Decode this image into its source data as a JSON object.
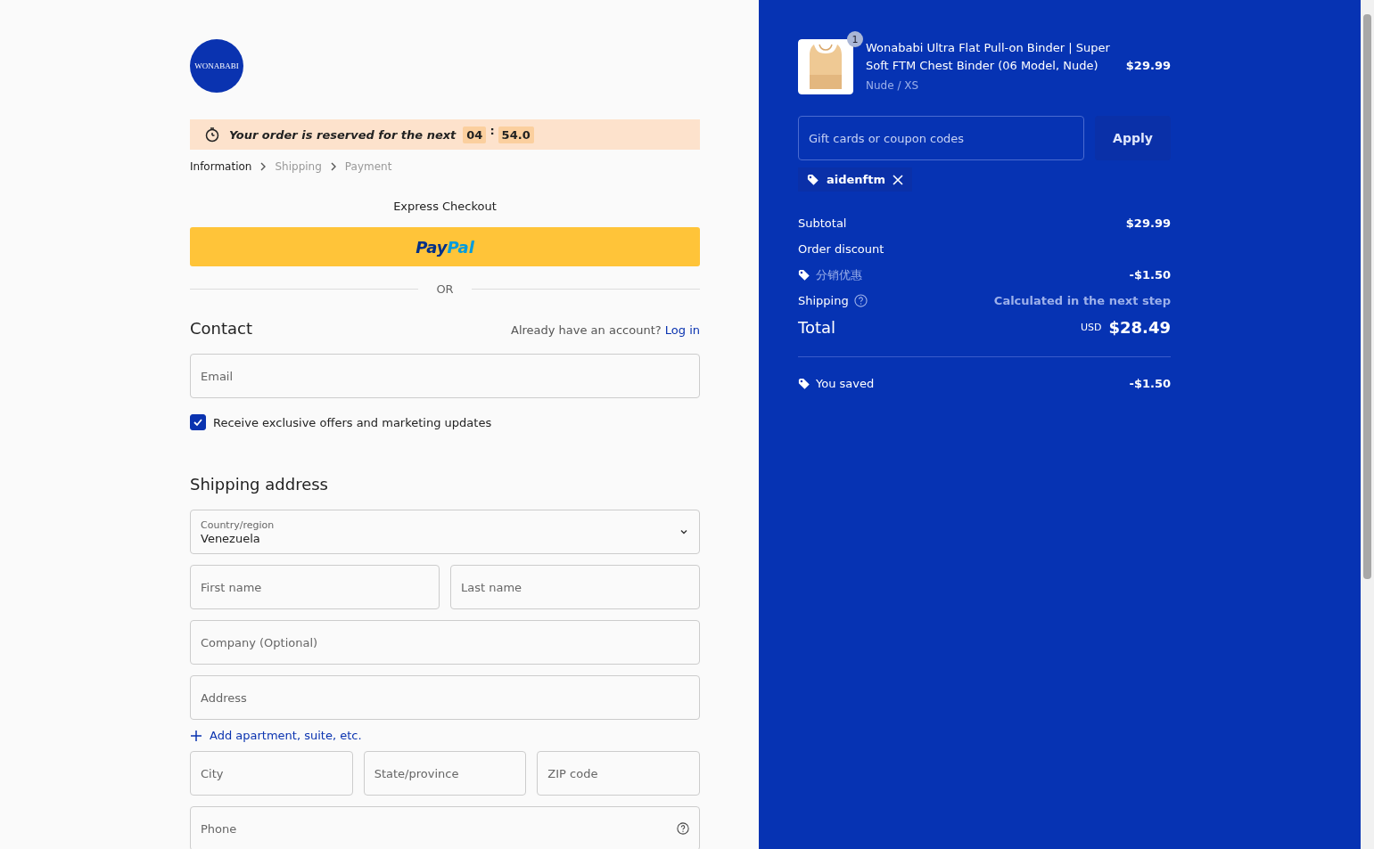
{
  "logo": {
    "text": "WONABABI"
  },
  "reservation": {
    "text": "Your order is reserved for the next",
    "minutes": "04",
    "separator": ":",
    "seconds": "54.0"
  },
  "breadcrumbs": [
    {
      "label": "Information",
      "selected": true
    },
    {
      "label": "Shipping",
      "selected": false
    },
    {
      "label": "Payment",
      "selected": false
    }
  ],
  "express_checkout": {
    "title": "Express Checkout",
    "paypal": {
      "pay": "Pay",
      "pal": "Pal"
    },
    "divider": "OR"
  },
  "contact": {
    "title": "Contact",
    "account_prompt": "Already have an account?",
    "login_link": "Log in",
    "email_placeholder": "Email",
    "marketing": {
      "label": "Receive exclusive offers and marketing updates",
      "checked": true
    }
  },
  "shipping_address": {
    "title": "Shipping address",
    "country": {
      "label": "Country/region",
      "value": "Venezuela"
    },
    "rows": [
      [
        {
          "placeholder": "First name"
        },
        {
          "placeholder": "Last name"
        }
      ],
      [
        {
          "placeholder": "Company (Optional)"
        }
      ],
      [
        {
          "placeholder": "Address"
        }
      ],
      [
        {
          "kind": "link",
          "label": "Add apartment, suite, etc."
        }
      ],
      [
        {
          "placeholder": "City"
        },
        {
          "placeholder": "State/province"
        },
        {
          "placeholder": "ZIP code"
        }
      ],
      [
        {
          "placeholder": "Phone",
          "help": true
        }
      ]
    ]
  },
  "summary": {
    "item": {
      "quantity": "1",
      "title": "Wonababi Ultra Flat Pull-on Binder | Super Soft FTM Chest Binder (06 Model, Nude)",
      "variant": "Nude / XS",
      "price": "$29.99"
    },
    "coupon": {
      "placeholder": "Gift cards or coupon codes",
      "button": "Apply",
      "applied": "aidenftm"
    },
    "lines": [
      {
        "kind": "row",
        "label": "Subtotal",
        "value": "$29.99"
      },
      {
        "kind": "heading",
        "label": "Order discount"
      },
      {
        "kind": "discount",
        "label": "分销优惠",
        "value": "-$1.50"
      },
      {
        "kind": "shipping",
        "label": "Shipping",
        "value": "Calculated in the next step"
      },
      {
        "kind": "total",
        "label": "Total",
        "currency": "USD",
        "value": "$28.49"
      }
    ],
    "saved": {
      "label": "You saved",
      "value": "-$1.50"
    }
  }
}
